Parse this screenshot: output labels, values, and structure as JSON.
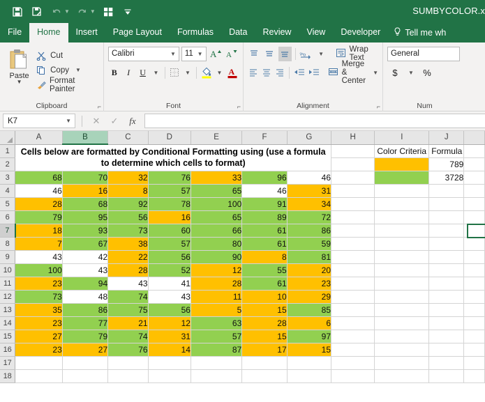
{
  "window": {
    "title": "SUMBYCOLOR.x",
    "accent": "#217346"
  },
  "quick_access": {
    "save_label": "Save",
    "save_as_label": "Save As",
    "undo_label": "Undo",
    "redo_label": "Redo",
    "quick_print_label": "Quick Print",
    "customize_label": "Customize Quick Access Toolbar"
  },
  "tabs": [
    {
      "label": "File",
      "active": false
    },
    {
      "label": "Home",
      "active": true
    },
    {
      "label": "Insert",
      "active": false
    },
    {
      "label": "Page Layout",
      "active": false
    },
    {
      "label": "Formulas",
      "active": false
    },
    {
      "label": "Data",
      "active": false
    },
    {
      "label": "Review",
      "active": false
    },
    {
      "label": "View",
      "active": false
    },
    {
      "label": "Developer",
      "active": false
    }
  ],
  "tell_me": "Tell me wh",
  "ribbon": {
    "clipboard": {
      "group_label": "Clipboard",
      "paste_label": "Paste",
      "cut_label": "Cut",
      "copy_label": "Copy",
      "format_painter_label": "Format Painter"
    },
    "font": {
      "group_label": "Font",
      "font_name": "Calibri",
      "font_size": "11",
      "grow_font_label": "A",
      "shrink_font_label": "A",
      "bold_label": "B",
      "italic_label": "I",
      "underline_label": "U"
    },
    "alignment": {
      "group_label": "Alignment",
      "wrap_text_label": "Wrap Text",
      "merge_center_label": "Merge & Center"
    },
    "number": {
      "group_label": "Num",
      "format_value": "General",
      "currency_label": "$",
      "percent_label": "%"
    }
  },
  "formula_bar": {
    "name_box": "K7",
    "cancel_label": "Cancel",
    "enter_label": "Enter",
    "insert_function_label": "fx",
    "formula_value": ""
  },
  "grid": {
    "columns": [
      "A",
      "B",
      "C",
      "D",
      "E",
      "F",
      "G",
      "H",
      "I",
      "J"
    ],
    "selected_column": "B",
    "selected_row": "7",
    "selected_cell": "K7",
    "row_numbers": [
      "1",
      "2",
      "3",
      "4",
      "5",
      "6",
      "7",
      "8",
      "9",
      "10",
      "11",
      "12",
      "13",
      "14",
      "15",
      "16",
      "17",
      "18"
    ],
    "banner_text": "Cells below are formatted by Conditional Formatting using (use a formula to determine which cells to format)",
    "legend": {
      "color_criteria_label": "Color Criteria",
      "formula_label": "Formula",
      "rows": [
        {
          "color": "orange",
          "value": "789"
        },
        {
          "color": "green",
          "value": "3728"
        }
      ]
    },
    "colors": {
      "green": "#92d050",
      "orange": "#ffc000",
      "blank": "#ffffff"
    },
    "data_rows": [
      {
        "row": "3",
        "cells": [
          {
            "v": "68",
            "c": "green"
          },
          {
            "v": "70",
            "c": "green"
          },
          {
            "v": "32",
            "c": "orange"
          },
          {
            "v": "76",
            "c": "green"
          },
          {
            "v": "33",
            "c": "orange"
          },
          {
            "v": "96",
            "c": "green"
          },
          {
            "v": "46",
            "c": "blank"
          }
        ]
      },
      {
        "row": "4",
        "cells": [
          {
            "v": "46",
            "c": "blank"
          },
          {
            "v": "16",
            "c": "orange"
          },
          {
            "v": "8",
            "c": "orange"
          },
          {
            "v": "57",
            "c": "green"
          },
          {
            "v": "65",
            "c": "green"
          },
          {
            "v": "46",
            "c": "blank"
          },
          {
            "v": "31",
            "c": "orange"
          }
        ]
      },
      {
        "row": "5",
        "cells": [
          {
            "v": "28",
            "c": "orange"
          },
          {
            "v": "68",
            "c": "green"
          },
          {
            "v": "92",
            "c": "green"
          },
          {
            "v": "78",
            "c": "green"
          },
          {
            "v": "100",
            "c": "green"
          },
          {
            "v": "91",
            "c": "green"
          },
          {
            "v": "34",
            "c": "orange"
          }
        ]
      },
      {
        "row": "6",
        "cells": [
          {
            "v": "79",
            "c": "green"
          },
          {
            "v": "95",
            "c": "green"
          },
          {
            "v": "56",
            "c": "green"
          },
          {
            "v": "16",
            "c": "orange"
          },
          {
            "v": "65",
            "c": "green"
          },
          {
            "v": "89",
            "c": "green"
          },
          {
            "v": "72",
            "c": "green"
          }
        ]
      },
      {
        "row": "7",
        "cells": [
          {
            "v": "18",
            "c": "orange"
          },
          {
            "v": "93",
            "c": "green"
          },
          {
            "v": "73",
            "c": "green"
          },
          {
            "v": "60",
            "c": "green"
          },
          {
            "v": "66",
            "c": "green"
          },
          {
            "v": "61",
            "c": "green"
          },
          {
            "v": "86",
            "c": "green"
          }
        ]
      },
      {
        "row": "8",
        "cells": [
          {
            "v": "7",
            "c": "orange"
          },
          {
            "v": "67",
            "c": "green"
          },
          {
            "v": "38",
            "c": "orange"
          },
          {
            "v": "57",
            "c": "green"
          },
          {
            "v": "80",
            "c": "green"
          },
          {
            "v": "61",
            "c": "green"
          },
          {
            "v": "59",
            "c": "green"
          }
        ]
      },
      {
        "row": "9",
        "cells": [
          {
            "v": "43",
            "c": "blank"
          },
          {
            "v": "42",
            "c": "blank"
          },
          {
            "v": "22",
            "c": "orange"
          },
          {
            "v": "56",
            "c": "green"
          },
          {
            "v": "90",
            "c": "green"
          },
          {
            "v": "8",
            "c": "orange"
          },
          {
            "v": "81",
            "c": "green"
          }
        ]
      },
      {
        "row": "10",
        "cells": [
          {
            "v": "100",
            "c": "green"
          },
          {
            "v": "43",
            "c": "blank"
          },
          {
            "v": "28",
            "c": "orange"
          },
          {
            "v": "52",
            "c": "green"
          },
          {
            "v": "12",
            "c": "orange"
          },
          {
            "v": "55",
            "c": "green"
          },
          {
            "v": "20",
            "c": "orange"
          }
        ]
      },
      {
        "row": "11",
        "cells": [
          {
            "v": "23",
            "c": "orange"
          },
          {
            "v": "94",
            "c": "green"
          },
          {
            "v": "43",
            "c": "blank"
          },
          {
            "v": "41",
            "c": "blank"
          },
          {
            "v": "28",
            "c": "orange"
          },
          {
            "v": "61",
            "c": "green"
          },
          {
            "v": "23",
            "c": "orange"
          }
        ]
      },
      {
        "row": "12",
        "cells": [
          {
            "v": "73",
            "c": "green"
          },
          {
            "v": "48",
            "c": "blank"
          },
          {
            "v": "74",
            "c": "green"
          },
          {
            "v": "43",
            "c": "blank"
          },
          {
            "v": "11",
            "c": "orange"
          },
          {
            "v": "10",
            "c": "orange"
          },
          {
            "v": "29",
            "c": "orange"
          }
        ]
      },
      {
        "row": "13",
        "cells": [
          {
            "v": "35",
            "c": "orange"
          },
          {
            "v": "86",
            "c": "green"
          },
          {
            "v": "75",
            "c": "green"
          },
          {
            "v": "56",
            "c": "green"
          },
          {
            "v": "5",
            "c": "orange"
          },
          {
            "v": "15",
            "c": "orange"
          },
          {
            "v": "85",
            "c": "green"
          }
        ]
      },
      {
        "row": "14",
        "cells": [
          {
            "v": "23",
            "c": "orange"
          },
          {
            "v": "77",
            "c": "green"
          },
          {
            "v": "21",
            "c": "orange"
          },
          {
            "v": "12",
            "c": "orange"
          },
          {
            "v": "63",
            "c": "green"
          },
          {
            "v": "28",
            "c": "orange"
          },
          {
            "v": "6",
            "c": "orange"
          }
        ]
      },
      {
        "row": "15",
        "cells": [
          {
            "v": "27",
            "c": "orange"
          },
          {
            "v": "79",
            "c": "green"
          },
          {
            "v": "74",
            "c": "green"
          },
          {
            "v": "31",
            "c": "orange"
          },
          {
            "v": "57",
            "c": "green"
          },
          {
            "v": "15",
            "c": "orange"
          },
          {
            "v": "97",
            "c": "green"
          }
        ]
      },
      {
        "row": "16",
        "cells": [
          {
            "v": "23",
            "c": "orange"
          },
          {
            "v": "27",
            "c": "orange"
          },
          {
            "v": "76",
            "c": "green"
          },
          {
            "v": "14",
            "c": "orange"
          },
          {
            "v": "87",
            "c": "green"
          },
          {
            "v": "17",
            "c": "orange"
          },
          {
            "v": "15",
            "c": "orange"
          }
        ]
      }
    ]
  }
}
